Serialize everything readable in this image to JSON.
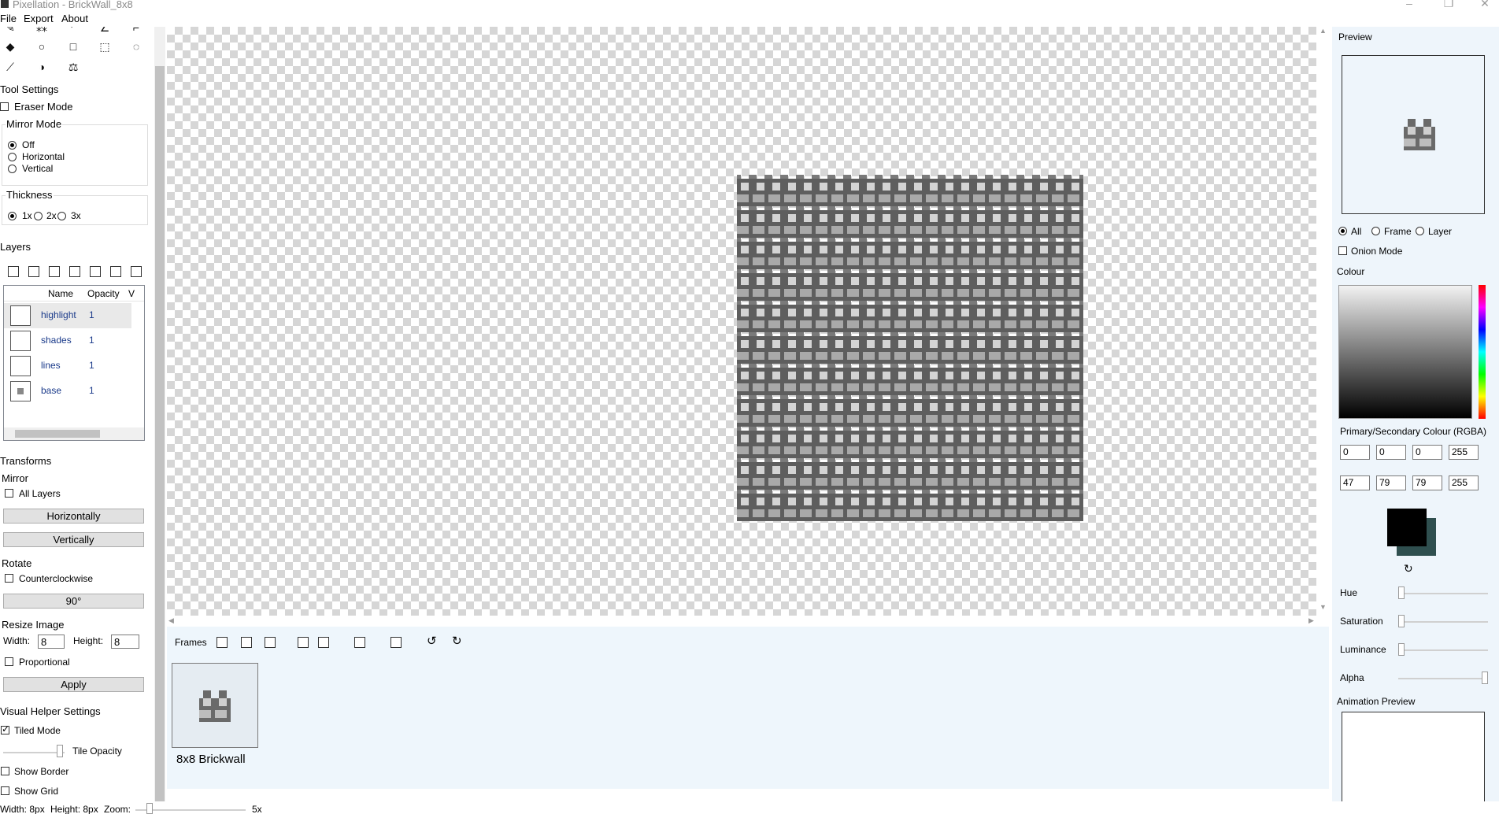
{
  "window": {
    "title": "Pixellation - BrickWall_8x8"
  },
  "menu": [
    "File",
    "Export",
    "About"
  ],
  "tools_panel": {
    "tool_settings_title": "Tool Settings",
    "eraser_mode": "Eraser Mode",
    "mirror_mode": {
      "title": "Mirror Mode",
      "options": [
        "Off",
        "Horizontal",
        "Vertical"
      ],
      "selected": "Off"
    },
    "thickness": {
      "title": "Thickness",
      "options": [
        "1x",
        "2x",
        "3x"
      ],
      "selected": "1x"
    }
  },
  "layers": {
    "title": "Layers",
    "columns": [
      "Name",
      "Opacity",
      "V"
    ],
    "rows": [
      {
        "name": "highlight",
        "opacity": "1"
      },
      {
        "name": "shades",
        "opacity": "1"
      },
      {
        "name": "lines",
        "opacity": "1"
      },
      {
        "name": "base",
        "opacity": "1"
      }
    ]
  },
  "transforms": {
    "title": "Transforms",
    "mirror_title": "Mirror",
    "all_layers": "All Layers",
    "horizontally": "Horizontally",
    "vertically": "Vertically",
    "rotate_title": "Rotate",
    "counterclockwise": "Counterclockwise",
    "rotate_90": "90°",
    "resize_title": "Resize Image",
    "width_label": "Width:",
    "width_value": "8",
    "height_label": "Height:",
    "height_value": "8",
    "proportional": "Proportional",
    "apply": "Apply"
  },
  "visual_helper": {
    "title": "Visual Helper Settings",
    "tiled_mode": "Tiled Mode",
    "tile_opacity": "Tile Opacity",
    "show_border": "Show Border",
    "show_grid": "Show Grid"
  },
  "status_bar": {
    "width": "Width: 8px",
    "height": "Height: 8px",
    "zoom_label": "Zoom:",
    "zoom_value": "5x"
  },
  "frames": {
    "label": "Frames",
    "items": [
      {
        "name": "8x8 Brickwall"
      }
    ]
  },
  "preview": {
    "title": "Preview",
    "modes": [
      "All",
      "Frame",
      "Layer"
    ],
    "selected": "All",
    "onion_mode": "Onion Mode"
  },
  "colour": {
    "title": "Colour",
    "rgba_title": "Primary/Secondary Colour (RGBA)",
    "primary": [
      "0",
      "0",
      "0",
      "255"
    ],
    "secondary": [
      "47",
      "79",
      "79",
      "255"
    ],
    "primary_hex": "#000000",
    "secondary_hex": "#2f4f4f",
    "sliders": [
      {
        "label": "Hue",
        "level": 0
      },
      {
        "label": "Saturation",
        "level": 0
      },
      {
        "label": "Luminance",
        "level": 0
      },
      {
        "label": "Alpha",
        "level": 1
      }
    ]
  },
  "animation_preview": {
    "title": "Animation Preview"
  }
}
